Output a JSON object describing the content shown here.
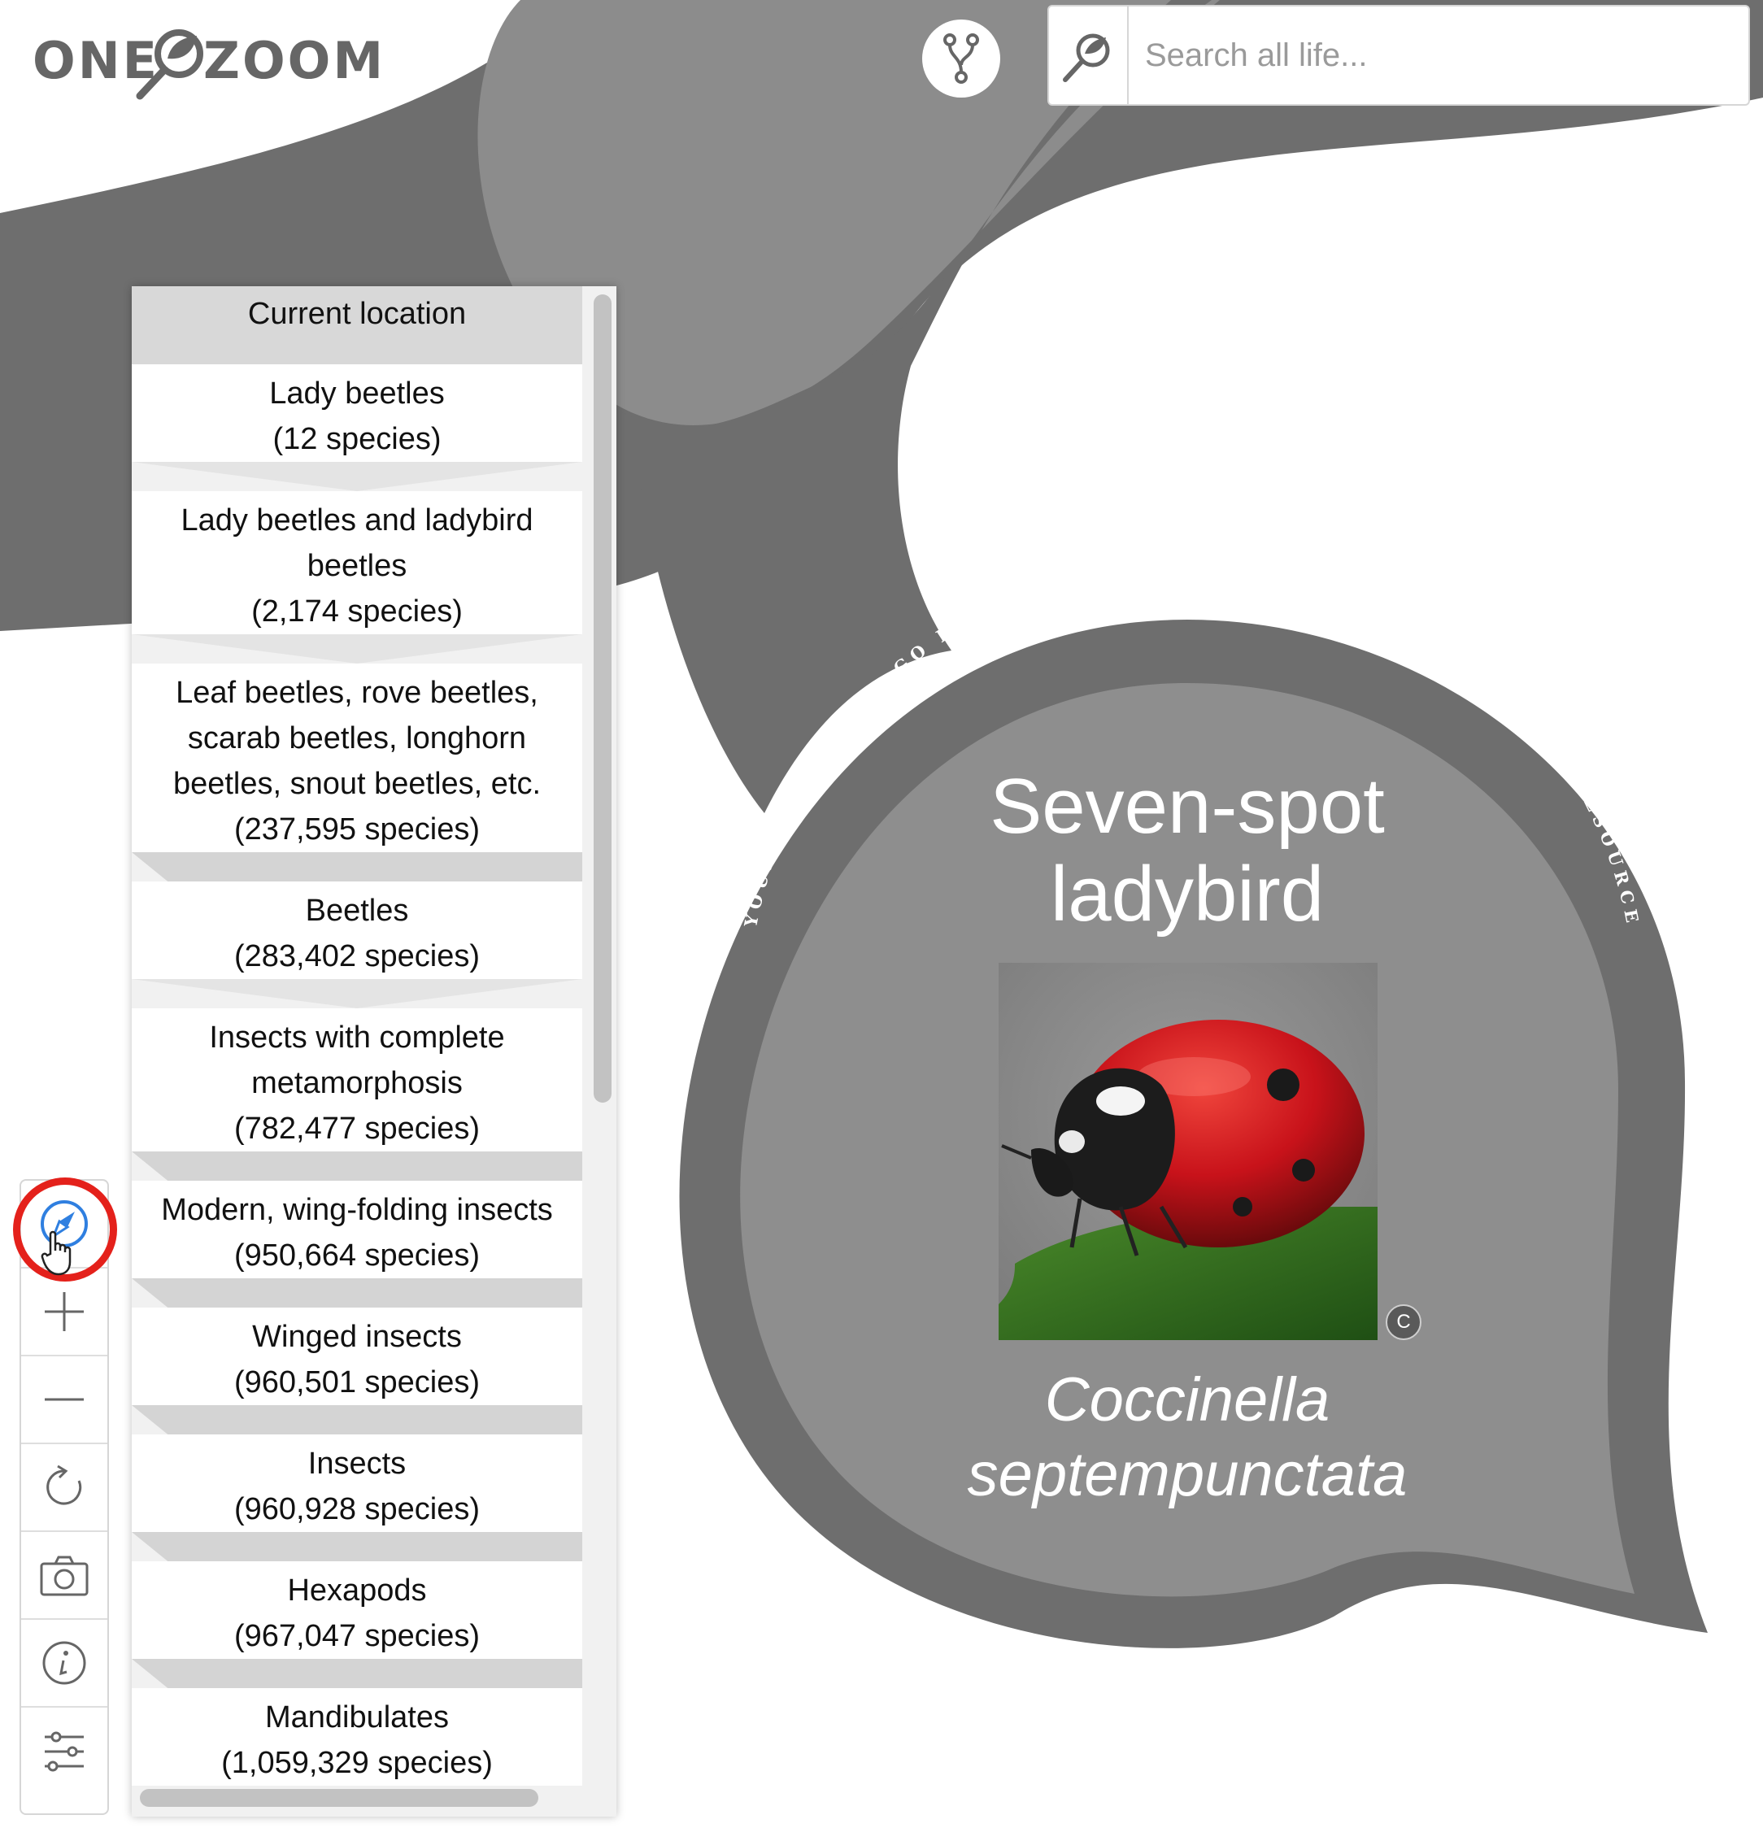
{
  "logo": {
    "word_left": "ONE",
    "word_right": "ZOOM"
  },
  "search": {
    "placeholder": "Search all life...",
    "value": ""
  },
  "location_panel": {
    "header": "Current location",
    "items": [
      {
        "name": "Lady beetles",
        "count": "(12 species)"
      },
      {
        "name": "Lady beetles and ladybird beetles",
        "count": "(2,174 species)"
      },
      {
        "name": "Leaf beetles, rove beetles, scarab beetles, longhorn beetles, snout beetles, etc.",
        "count": "(237,595 species)"
      },
      {
        "name": "Beetles",
        "count": "(283,402 species)"
      },
      {
        "name": "Insects with complete metamorphosis",
        "count": "(782,477 species)"
      },
      {
        "name": "Modern, wing-folding insects",
        "count": "(950,664 species)"
      },
      {
        "name": "Winged insects",
        "count": "(960,501 species)"
      },
      {
        "name": "Insects",
        "count": "(960,928 species)"
      },
      {
        "name": "Hexapods",
        "count": "(967,047 species)"
      },
      {
        "name": "Mandibulates",
        "count": "(1,059,329 species)"
      }
    ]
  },
  "toolbar": {
    "tools": [
      "compass-icon",
      "zoom-in-icon",
      "zoom-out-icon",
      "reset-icon",
      "camera-icon",
      "info-icon",
      "settings-sliders-icon"
    ]
  },
  "leaf": {
    "common_name": "Seven-spot ladybird",
    "scientific_name": "Coccinella septempunctata",
    "arc_text": "YOUR NAME COULD GO HERE. DONATIONS HELP IMPROVE THIS PUBLIC RESOURCE",
    "copyright_symbol": "C"
  },
  "colors": {
    "branch_dark": "#6e6e6e",
    "branch_light": "#8c8c8c",
    "leaf_inner": "#8e8e8e",
    "highlight_ring": "#e4211b",
    "compass_blue": "#2f7fe0",
    "ladybird_red": "#c8121a"
  }
}
